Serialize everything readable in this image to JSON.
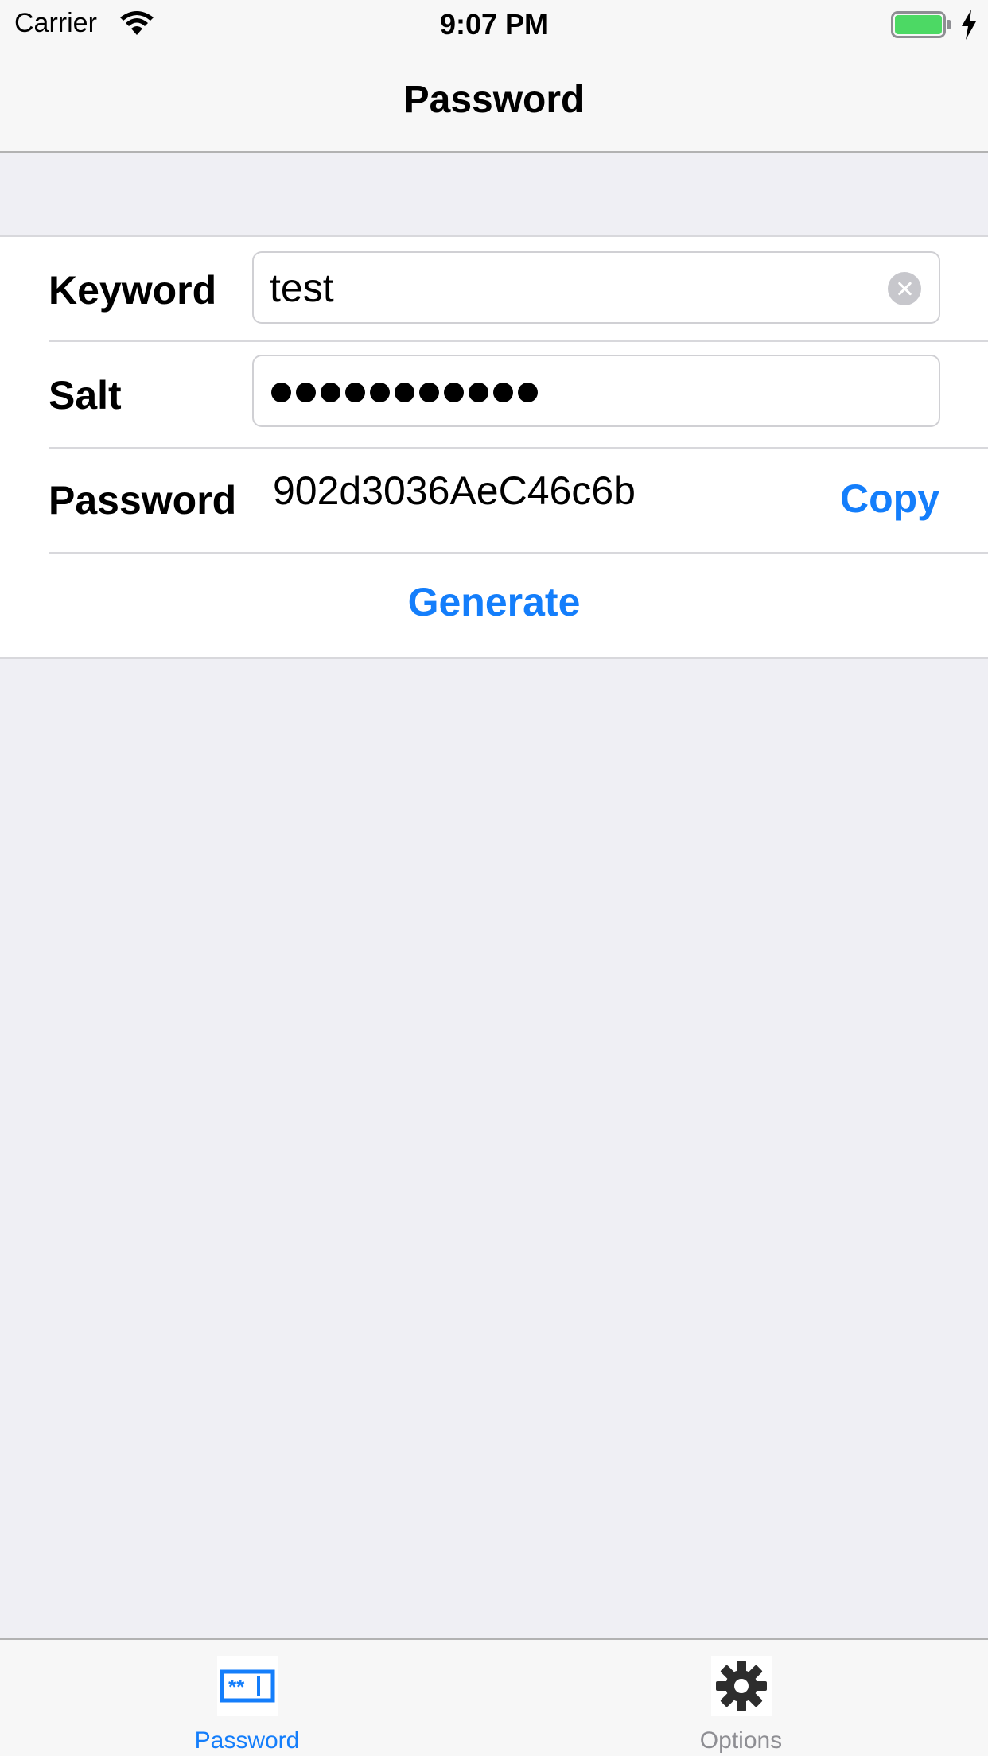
{
  "status_bar": {
    "carrier": "Carrier",
    "time": "9:07 PM",
    "battery_color": "#4cd964"
  },
  "nav": {
    "title": "Password"
  },
  "form": {
    "keyword": {
      "label": "Keyword",
      "value": "test",
      "clear_icon": "clear-circle-icon"
    },
    "salt": {
      "label": "Salt",
      "masked_char_count": 11
    },
    "password": {
      "label": "Password",
      "value": "902d3036AeC46c6b",
      "copy_label": "Copy"
    },
    "generate_label": "Generate"
  },
  "tab_bar": {
    "tabs": [
      {
        "label": "Password",
        "icon": "password-field-icon",
        "active": true
      },
      {
        "label": "Options",
        "icon": "gear-icon",
        "active": false
      }
    ]
  },
  "colors": {
    "accent": "#147efb",
    "inactive": "#8e8e93",
    "background": "#efeff4"
  }
}
